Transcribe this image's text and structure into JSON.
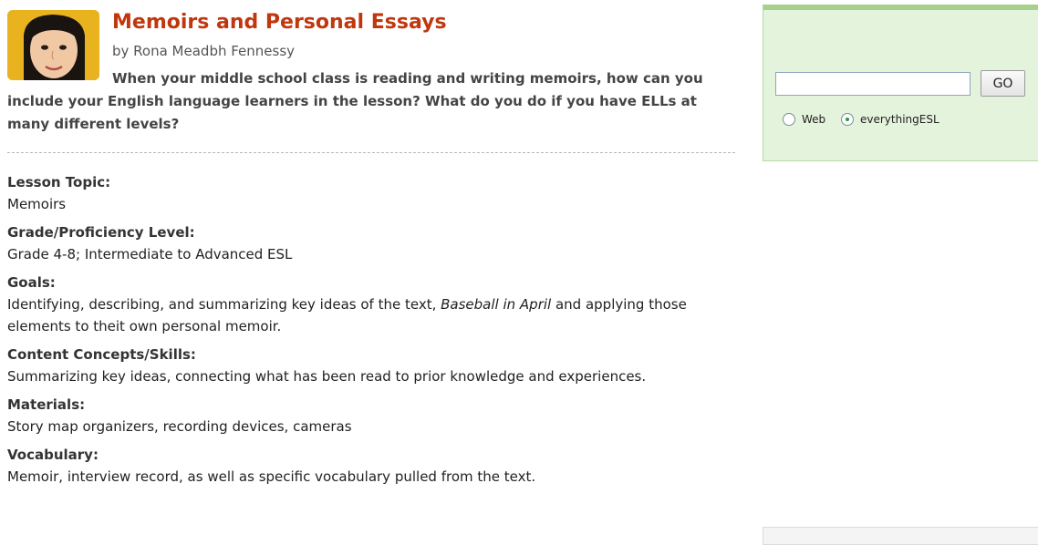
{
  "article": {
    "title": "Memoirs and Personal Essays",
    "byline": "by Rona Meadbh Fennessy",
    "intro": "When your middle school class is reading and writing memoirs, how can you include your English language learners in the lesson? What do you do if you have ELLs at many different levels?"
  },
  "lesson": {
    "topic_label": "Lesson Topic:",
    "topic_value": "Memoirs",
    "grade_label": "Grade/Proficiency Level:",
    "grade_value": "Grade 4-8; Intermediate to Advanced ESL",
    "goals_label": "Goals:",
    "goals_text_before": "Identifying, describing, and summarizing key ideas of the text, ",
    "goals_book": "Baseball in April",
    "goals_text_after": " and applying those elements to theit own personal memoir.",
    "skills_label": "Content Concepts/Skills:",
    "skills_value": "Summarizing key ideas, connecting what has been read to prior knowledge and experiences.",
    "materials_label": "Materials:",
    "materials_value": "Story map organizers, recording devices, cameras",
    "vocab_label": "Vocabulary:",
    "vocab_value": "Memoir, interview record, as well as specific vocabulary pulled from the text."
  },
  "search": {
    "input_value": "",
    "go_label": "GO",
    "option_web": "Web",
    "option_site": "everythingESL",
    "selected": "everythingESL"
  },
  "colors": {
    "title": "#c0370e",
    "search_panel_bg": "#e4f3dc",
    "search_panel_border": "#a8d08d"
  }
}
